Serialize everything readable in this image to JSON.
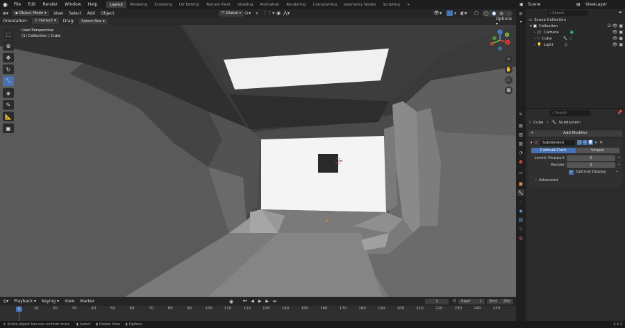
{
  "topbar": {
    "menus": [
      "File",
      "Edit",
      "Render",
      "Window",
      "Help"
    ],
    "workspaces": [
      "Layout",
      "Modeling",
      "Sculpting",
      "UV Editing",
      "Texture Paint",
      "Shading",
      "Animation",
      "Rendering",
      "Compositing",
      "Geometry Nodes",
      "Scripting"
    ],
    "active_workspace": "Layout",
    "add_tab": "+",
    "scene": "Scene",
    "view_layer": "ViewLayer"
  },
  "viewport_header": {
    "mode": "Object Mode",
    "menus": [
      "View",
      "Select",
      "Add",
      "Object"
    ],
    "transform": "Global"
  },
  "tool_header": {
    "orientation_label": "Orientation:",
    "orientation_value": "Default",
    "drag_label": "Drag:",
    "drag_value": "Select Box",
    "options": "Options"
  },
  "viewport": {
    "perspective": "User Perspective",
    "collection_info": "(1) Collection | Cube"
  },
  "gizmo": {
    "z": "Z",
    "y": "Y",
    "x": "X"
  },
  "outliner": {
    "search_placeholder": "Search",
    "scene_collection": "Scene Collection",
    "collection": "Collection",
    "items": [
      "Camera",
      "Cube",
      "Light"
    ]
  },
  "properties": {
    "search_placeholder": "Search",
    "object_name": "Cube",
    "modifier_path": "Subdivision",
    "add_modifier": "Add Modifier",
    "modifier_name": "Subdivision",
    "algo_catmull": "Catmull-Clark",
    "algo_simple": "Simple",
    "levels_viewport_label": "Levels Viewport",
    "levels_viewport_value": "0",
    "render_label": "Render",
    "render_value": "2",
    "optimal_display": "Optimal Display",
    "advanced": "Advanced"
  },
  "timeline": {
    "menus": [
      "Playback",
      "Keying",
      "View",
      "Marker"
    ],
    "current_frame": "1",
    "start_label": "Start",
    "start_value": "1",
    "end_label": "End",
    "end_value": "250",
    "ticks": [
      "1",
      "10",
      "20",
      "30",
      "40",
      "50",
      "60",
      "70",
      "80",
      "90",
      "100",
      "110",
      "120",
      "130",
      "140",
      "150",
      "160",
      "170",
      "180",
      "190",
      "200",
      "210",
      "220",
      "230",
      "240",
      "250"
    ],
    "frame_marker": "1"
  },
  "statusbar": {
    "warning": "Active object has non-uniform scale",
    "select": "Select",
    "rotate": "Rotate View",
    "options": "Options",
    "version": "4.4.3"
  }
}
